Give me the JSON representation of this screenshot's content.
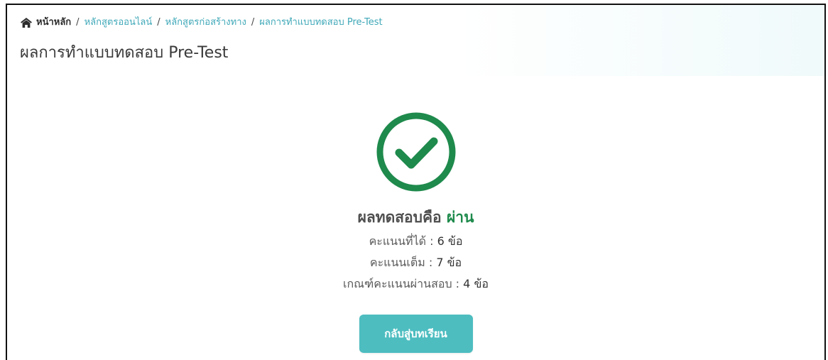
{
  "breadcrumb": {
    "home": "หน้าหลัก",
    "separator": "/",
    "items": [
      "หลักสูตรออนไลน์",
      "หลักสูตรก่อสร้างทาง",
      "ผลการทำแบบทดสอบ Pre-Test"
    ]
  },
  "page_title": "ผลการทำแบบทดสอบ Pre-Test",
  "result": {
    "icon": "check-circle-icon",
    "heading_prefix": "ผลทดสอบคือ",
    "status": "ผ่าน",
    "score": {
      "label": "คะแนนที่ได้ :",
      "value": "6 ข้อ"
    },
    "full_score": {
      "label": "คะแนนเต็ม :",
      "value": "7 ข้อ"
    },
    "pass_criteria": {
      "label": "เกณฑ์คะแนนผ่านสอบ :",
      "value": "4 ข้อ"
    }
  },
  "back_button_label": "กลับสู่บทเรียน",
  "colors": {
    "pass_green": "#1e8a4c",
    "link_teal": "#3fa8b8",
    "button_teal": "#4dbdc0"
  }
}
